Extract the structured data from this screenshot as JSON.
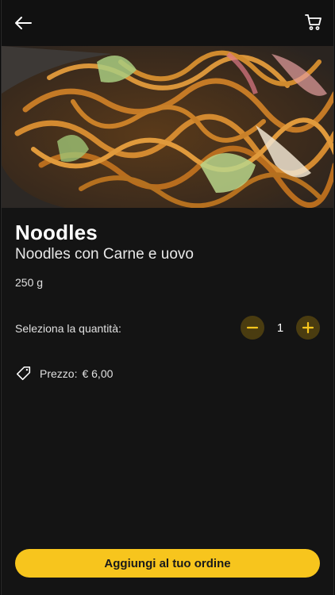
{
  "header": {
    "back_icon": "arrow-left-icon",
    "cart_icon": "shopping-cart-icon"
  },
  "product": {
    "image_alt": "noodles-photo",
    "name": "Noodles",
    "description": "Noodles con Carne e uovo",
    "weight": "250 g"
  },
  "quantity": {
    "label": "Seleziona la quantità:",
    "value": "1",
    "decrement_icon": "minus-icon",
    "increment_icon": "plus-icon"
  },
  "price": {
    "icon": "price-tag-icon",
    "label": "Prezzo:",
    "value": "€ 6,00"
  },
  "cta": {
    "label": "Aggiungi al tuo ordine"
  },
  "colors": {
    "accent": "#f7c51d",
    "accent_dark": "#4a3c10",
    "background": "#141414"
  }
}
